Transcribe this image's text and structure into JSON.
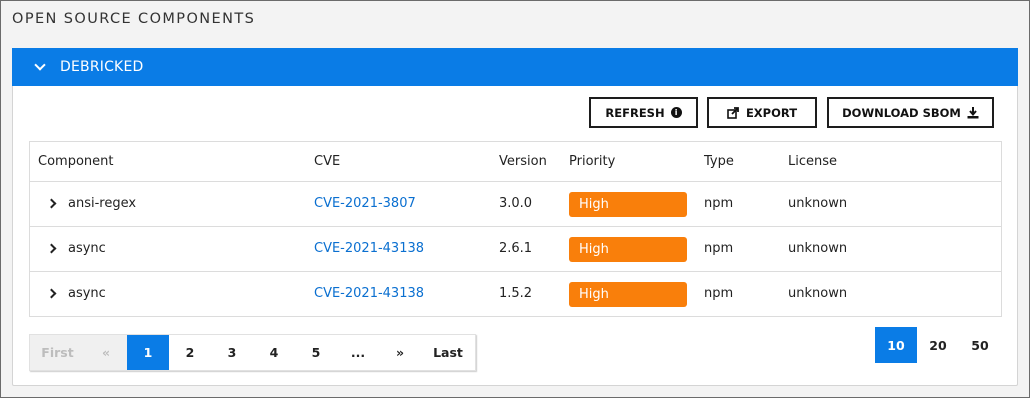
{
  "page_title": "OPEN SOURCE COMPONENTS",
  "panel": {
    "title": "DEBRICKED"
  },
  "toolbar": {
    "refresh_label": "REFRESH",
    "export_label": "EXPORT",
    "download_label": "DOWNLOAD SBOM"
  },
  "table": {
    "headers": [
      "Component",
      "CVE",
      "Version",
      "Priority",
      "Type",
      "License"
    ],
    "rows": [
      {
        "component": "ansi-regex",
        "cve": "CVE-2021-3807",
        "version": "3.0.0",
        "priority": "High",
        "type": "npm",
        "license": "unknown"
      },
      {
        "component": "async",
        "cve": "CVE-2021-43138",
        "version": "2.6.1",
        "priority": "High",
        "type": "npm",
        "license": "unknown"
      },
      {
        "component": "async",
        "cve": "CVE-2021-43138",
        "version": "1.5.2",
        "priority": "High",
        "type": "npm",
        "license": "unknown"
      }
    ]
  },
  "pagination": {
    "first": "First",
    "prev": "«",
    "pages": [
      "1",
      "2",
      "3",
      "4",
      "5"
    ],
    "current_page": "1",
    "ellipsis": "...",
    "next": "»",
    "last": "Last"
  },
  "page_size": {
    "options": [
      "10",
      "20",
      "50"
    ],
    "selected": "10"
  },
  "colors": {
    "accent": "#0a7ce6",
    "priority_high": "#f97f0b",
    "link": "#0a6fd0"
  }
}
